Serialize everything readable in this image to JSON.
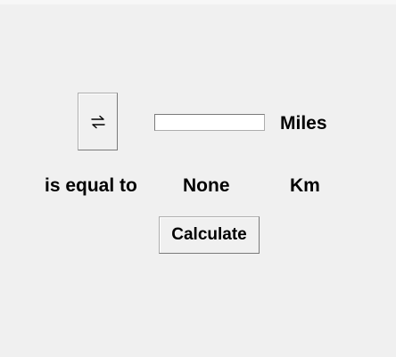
{
  "window": {
    "background": "#f0f0f0"
  },
  "swap_button": {
    "icon": "swap-arrows-icon",
    "glyph": "⇄"
  },
  "miles_input": {
    "value": "",
    "placeholder": ""
  },
  "labels": {
    "miles": "Miles",
    "is_equal_to": "is equal to",
    "result": "None",
    "km": "Km"
  },
  "calculate_button": {
    "label": "Calculate"
  }
}
